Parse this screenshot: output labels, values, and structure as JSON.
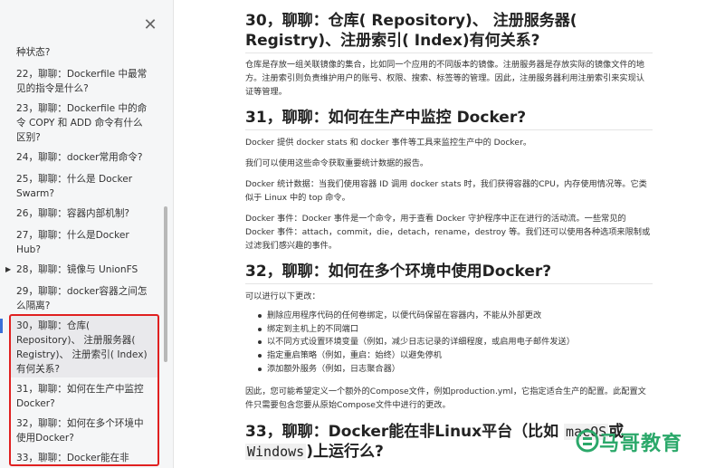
{
  "sidebar": {
    "items": [
      {
        "label": "种状态?"
      },
      {
        "label": "22，聊聊：Dockerfile 中最常见的指令是什么?"
      },
      {
        "label": "23，聊聊：Dockerfile 中的命令 COPY 和 ADD 命令有什么区别?"
      },
      {
        "label": "24，聊聊：docker常用命令?"
      },
      {
        "label": "25，聊聊：什么是 Docker Swarm?"
      },
      {
        "label": "26，聊聊：容器内部机制?"
      },
      {
        "label": "27，聊聊：什么是Docker Hub?"
      },
      {
        "label": "28，聊聊：镜像与 UnionFS"
      },
      {
        "label": "29，聊聊：docker容器之间怎么隔离?"
      },
      {
        "label": "30，聊聊：仓库( Repository)、 注册服务器( Registry)、 注册索引( Index)有何关系?"
      },
      {
        "label": "31，聊聊：如何在生产中监控 Docker?"
      },
      {
        "label": "32，聊聊：如何在多个环境中使用Docker?"
      },
      {
        "label": "33，聊聊：Docker能在非"
      }
    ]
  },
  "main": {
    "h30": "30，聊聊：仓库( Repository)、 注册服务器( Registry)、注册索引( Index)有何关系?",
    "p30": "仓库是存放一组关联镜像的集合，比如同一个应用的不同版本的镜像。注册服务器是存放实际的镜像文件的地方。注册索引则负责维护用户的账号、权限、搜索、标签等的管理。因此，注册服务器利用注册索引来实现认证等管理。",
    "h31": "31，聊聊：如何在生产中监控 Docker?",
    "p31a": "Docker 提供 docker stats 和 docker 事件等工具来监控生产中的 Docker。",
    "p31b": "我们可以使用这些命令获取重要统计数据的报告。",
    "p31c": "Docker 统计数据：当我们使用容器 ID 调用 docker stats 时，我们获得容器的CPU，内存使用情况等。它类似于 Linux 中的 top 命令。",
    "p31d": "Docker 事件：Docker 事件是一个命令，用于查看 Docker 守护程序中正在进行的活动流。一些常见的 Docker 事件：attach，commit，die，detach，rename，destroy 等。我们还可以使用各种选项来限制或过滤我们感兴趣的事件。",
    "h32": "32，聊聊：如何在多个环境中使用Docker?",
    "p32a": "可以进行以下更改：",
    "bullets32": [
      "删除应用程序代码的任何卷绑定，以便代码保留在容器内，不能从外部更改",
      "绑定到主机上的不同端口",
      "以不同方式设置环境变量（例如，减少日志记录的详细程度，或启用电子邮件发送）",
      "指定重启策略（例如，重启：始终）以避免停机",
      "添加额外服务（例如，日志聚合器）"
    ],
    "p32b": "因此，您可能希望定义一个额外的Compose文件，例如production.yml，它指定适合生产的配置。此配置文件只需要包含您要从原始Compose文件中进行的更改。",
    "h33_pre": "33，聊聊：Docker能在非Linux平台（比如 ",
    "h33_code1": "macOS",
    "h33_mid": "或",
    "h33_code2": "Windows",
    "h33_post": ")上运行么?"
  },
  "watermark": {
    "text": "马哥教育"
  },
  "colors": {
    "highlight": "#e02020",
    "watermark": "#2ba86a",
    "sidebar_bg": "#f5f6f7"
  }
}
